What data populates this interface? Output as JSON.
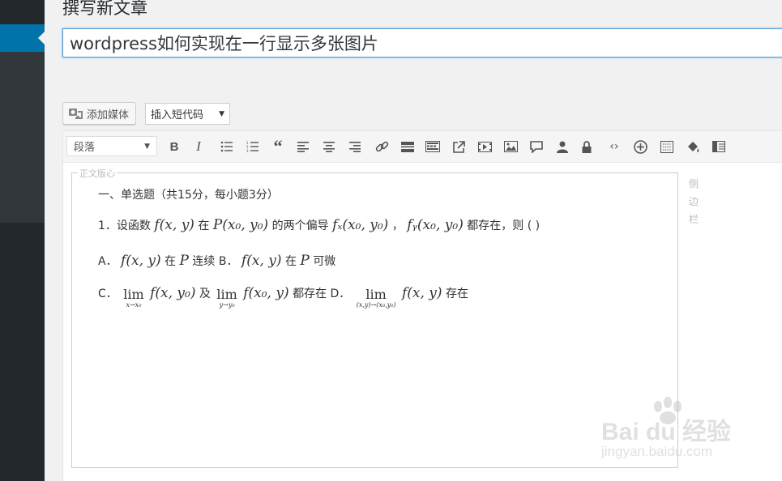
{
  "page": {
    "title": "撰写新文章"
  },
  "post": {
    "title_value": "wordpress如何实现在一行显示多张图片"
  },
  "media_buttons": {
    "add_media": "添加媒体",
    "shortcode_select": "插入短代码"
  },
  "toolbar": {
    "format_select": "段落",
    "buttons": [
      "bold",
      "italic",
      "bullet-list",
      "numbered-list",
      "blockquote",
      "align-left",
      "align-center",
      "align-right",
      "link",
      "read-more",
      "toolbar-toggle",
      "external-link",
      "video",
      "image",
      "comment",
      "user",
      "lock",
      "code",
      "add",
      "table-grid",
      "paint-bucket",
      "columns"
    ]
  },
  "editor": {
    "box_legend": "正文版心",
    "side_label": "侧边栏",
    "lines": {
      "heading": "一、单选题（共15分，每小题3分）",
      "q1_prefix": "1．设函数",
      "q1_f": "f(x, y)",
      "q1_mid": "在",
      "q1_P": "P(x₀, y₀)",
      "q1_mid2": "的两个偏导",
      "q1_fx": "fₓ(x₀, y₀)",
      "q1_comma": "，",
      "q1_fy": "fᵧ(x₀, y₀)",
      "q1_suffix": "都存在，则 ( )",
      "a_label": "A．",
      "a_f": "f(x, y)",
      "a_text1": "在",
      "a_P": "P",
      "a_text2": "连续 B．",
      "b_f": "f(x, y)",
      "b_text1": "在",
      "b_P": "P",
      "b_text2": "可微",
      "c_label": "C．",
      "c_lim": "lim",
      "c_lim_sub": "x→x₀",
      "c_f": "f(x, y₀)",
      "c_and": "及",
      "c_lim2": "lim",
      "c_lim2_sub": "y→y₀",
      "c_f2": "f(x₀, y)",
      "c_text": "都存在 D．",
      "d_lim": "lim",
      "d_lim_sub": "(x,y)→(x₀,y₀)",
      "d_f": "f(x, y)",
      "d_text": "存在"
    }
  },
  "watermark": {
    "brand": "Bai du 经验",
    "url": "jingyan.baidu.com"
  },
  "colors": {
    "accent": "#0073aa",
    "sidebar": "#23282d"
  }
}
